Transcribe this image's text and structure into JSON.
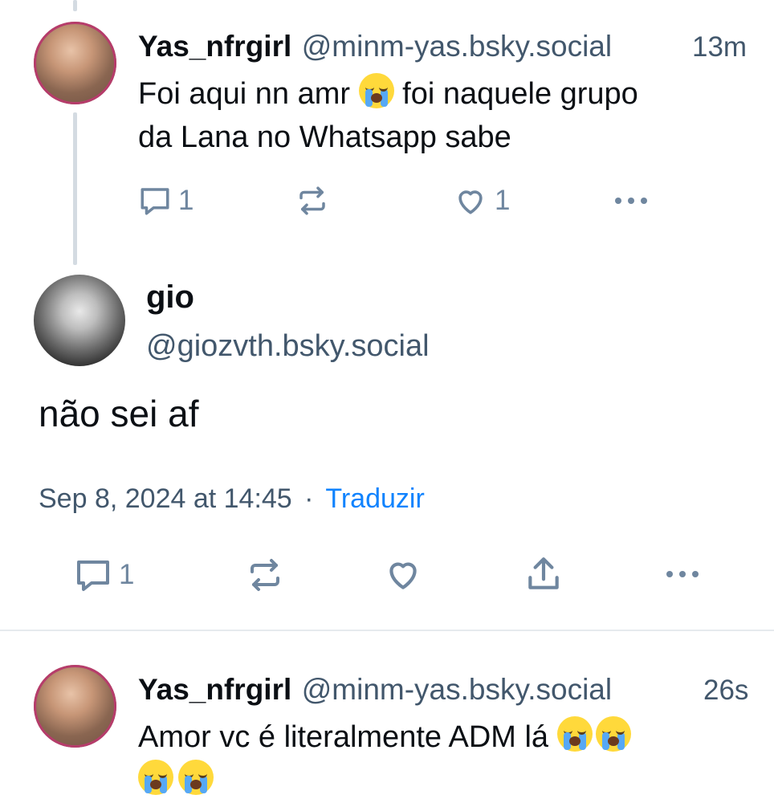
{
  "posts": [
    {
      "name": "Yas_nfrgirl",
      "handle": "@minm-yas.bsky.social",
      "time": "13m",
      "text_a": "Foi aqui nn amr ",
      "text_b": " foi naquele grupo",
      "text_c": "da Lana no Whatsapp sabe",
      "reply_count": "1",
      "like_count": "1"
    },
    {
      "name": "gio",
      "handle": "@giozvth.bsky.social",
      "text": "não sei af",
      "date": "Sep 8, 2024 at 14:45",
      "separator": "·",
      "translate": "Traduzir",
      "reply_count": "1"
    },
    {
      "name": "Yas_nfrgirl",
      "handle": "@minm-yas.bsky.social",
      "time": "26s",
      "text": "Amor vc é literalmente ADM lá "
    }
  ],
  "colors": {
    "text": "#0b0f14",
    "muted": "#42576c",
    "icon": "#6f869f",
    "link": "#1083fe",
    "thread_line": "#d4dbe2"
  },
  "icons": [
    "reply-icon",
    "repost-icon",
    "like-icon",
    "share-icon",
    "more-icon",
    "loudly-crying-face-emoji"
  ]
}
